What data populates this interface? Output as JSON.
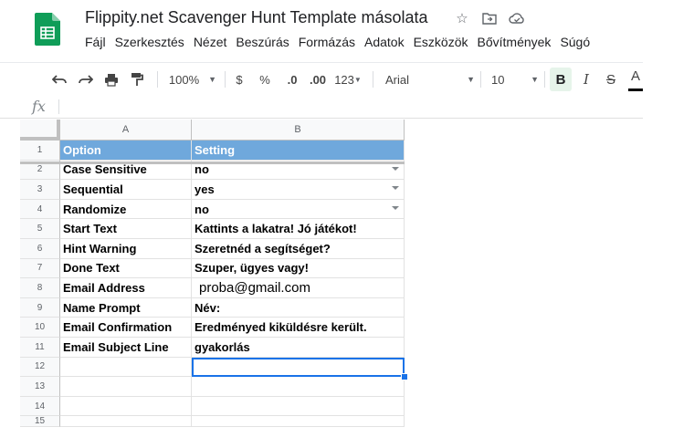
{
  "title": "Flippity.net Scavenger Hunt Template másolata",
  "menu": [
    "Fájl",
    "Szerkesztés",
    "Nézet",
    "Beszúrás",
    "Formázás",
    "Adatok",
    "Eszközök",
    "Bővítmények",
    "Súgó"
  ],
  "toolbar": {
    "zoom": "100%",
    "currency": "$",
    "percent": "%",
    "decrease_decimal": ".0",
    "increase_decimal": ".00",
    "more_formats": "123",
    "font": "Arial",
    "font_size": "10",
    "bold": "B",
    "italic": "I",
    "strike": "S",
    "text_color": "A"
  },
  "formula_label": "fx",
  "columns": [
    "A",
    "B"
  ],
  "rows": [
    {
      "n": "1",
      "a": "Option",
      "b": "Setting",
      "header": true
    },
    {
      "n": "2",
      "a": "Case Sensitive",
      "b": "no",
      "dropdown": true
    },
    {
      "n": "3",
      "a": "Sequential",
      "b": "yes",
      "dropdown": true
    },
    {
      "n": "4",
      "a": "Randomize",
      "b": "no",
      "dropdown": true
    },
    {
      "n": "5",
      "a": "Start Text",
      "b": "Kattints a lakatra! Jó játékot!"
    },
    {
      "n": "6",
      "a": "Hint Warning",
      "b": "Szeretnéd a segítséget?"
    },
    {
      "n": "7",
      "a": "Done Text",
      "b": "Szuper, ügyes vagy!"
    },
    {
      "n": "8",
      "a": "Email Address",
      "b": "proba@gmail.com",
      "plain": true
    },
    {
      "n": "9",
      "a": "Name Prompt",
      "b": "Név:"
    },
    {
      "n": "10",
      "a": "Email Confirmation",
      "b": "Eredményed kiküldésre került."
    },
    {
      "n": "11",
      "a": "Email Subject Line",
      "b": "gyakorlás"
    },
    {
      "n": "12",
      "a": "",
      "b": "",
      "selected": true
    },
    {
      "n": "13",
      "a": "",
      "b": ""
    },
    {
      "n": "14",
      "a": "",
      "b": ""
    },
    {
      "n": "15",
      "a": "",
      "b": ""
    }
  ],
  "colors": {
    "header_fill": "#6fa8dc",
    "selection": "#1a73e8",
    "logo": "#0f9d58"
  }
}
